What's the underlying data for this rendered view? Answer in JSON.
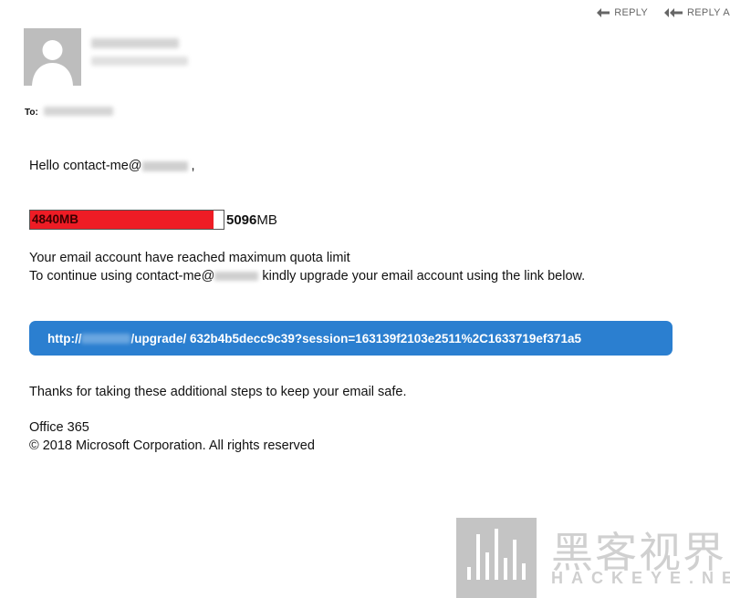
{
  "header": {
    "reply_label": "REPLY",
    "reply_all_label": "REPLY A"
  },
  "recipient": {
    "to_label": "To:"
  },
  "body": {
    "greeting_prefix": "Hello contact-me@",
    "greeting_suffix": " ,",
    "quota": {
      "used_label": "4840MB",
      "total_number": "5096",
      "total_unit": "MB",
      "used_fraction": 0.95
    },
    "message_line1": "Your email account have reached maximum quota limit",
    "message_line2_prefix": "To continue using contact-me@",
    "message_line2_suffix": " kindly upgrade your email account using the link below.",
    "link_prefix": "http://",
    "link_suffix": "/upgrade/ 632b4b5decc9c39?session=163139f2103e2511%2C1633719ef371a5",
    "thanks": "Thanks for taking these additional steps to keep your email safe.",
    "signature_line1": "Office 365",
    "signature_line2": "© 2018 Microsoft Corporation. All rights reserved"
  },
  "watermark": {
    "cn_text": "黑客视界",
    "en_text": "HACKEYE.NET"
  },
  "colors": {
    "quota_fill": "#ee1c25",
    "link_button": "#2b7fd0"
  }
}
